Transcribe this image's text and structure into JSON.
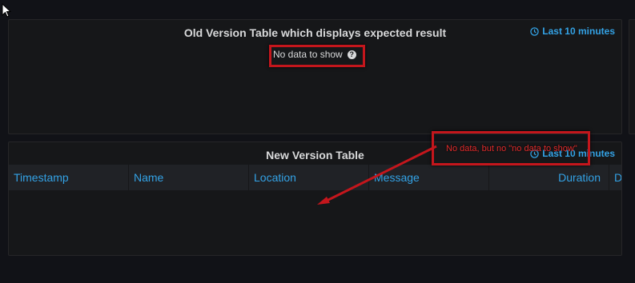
{
  "old_panel": {
    "title": "Old Version Table which displays expected result",
    "time_range": "Last 10 minutes",
    "no_data": "No data to show",
    "help_icon": "?"
  },
  "new_panel": {
    "title": "New Version Table",
    "time_range": "Last 10 minutes",
    "columns": [
      "Timestamp",
      "Name",
      "Location",
      "Message",
      "Duration",
      "D"
    ]
  },
  "annotation": {
    "text": "No data, but no \"no data to show\"",
    "color": "#e02b2b"
  },
  "icons": [
    "cursor-icon",
    "clock-icon",
    "help-icon",
    "arrow-icon"
  ],
  "colors": {
    "background": "#111217",
    "panel": "#161719",
    "accent": "#33a2e5",
    "annotation": "#c4161c"
  }
}
